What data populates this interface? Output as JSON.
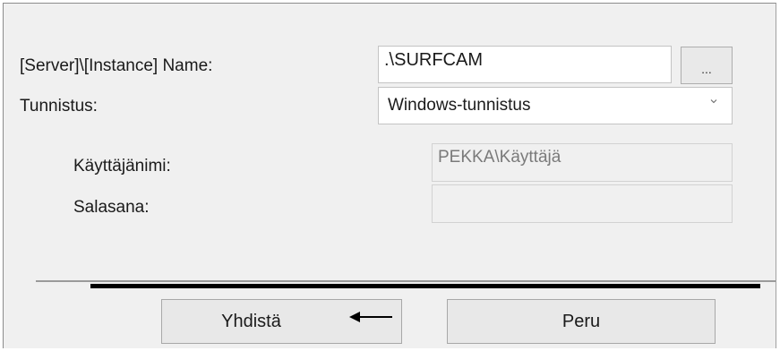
{
  "form": {
    "server_label": "[Server]\\[Instance] Name:",
    "server_value": ".\\SURFCAM",
    "browse_label": "...",
    "auth_label": "Tunnistus:",
    "auth_value": "Windows-tunnistus",
    "username_label": "Käyttäjänimi:",
    "username_value": "PEKKA\\Käyttäjä",
    "password_label": "Salasana:",
    "password_value": ""
  },
  "buttons": {
    "connect_label": "Yhdistä",
    "cancel_label": "Peru"
  },
  "icons": {
    "dropdown": "chevron-down-icon",
    "annotation": "arrow-left-icon"
  }
}
